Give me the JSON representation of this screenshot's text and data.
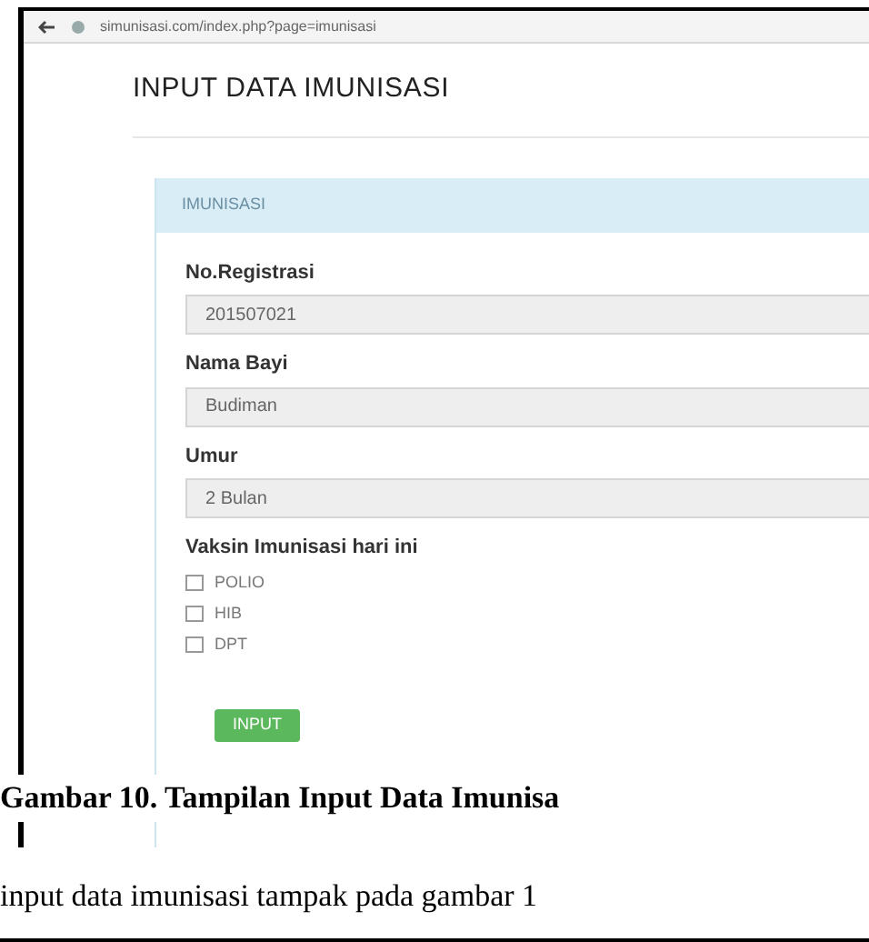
{
  "browser": {
    "url": "simunisasi.com/index.php?page=imunisasi"
  },
  "page": {
    "title": "INPUT DATA IMUNISASI"
  },
  "panel": {
    "heading": "IMUNISASI",
    "fields": [
      {
        "label": "No.Registrasi",
        "value": "201507021"
      },
      {
        "label": "Nama Bayi",
        "value": "Budiman"
      },
      {
        "label": "Umur",
        "value": "2 Bulan"
      }
    ],
    "vaccines_label": "Vaksin Imunisasi hari ini",
    "vaccines": [
      {
        "label": "POLIO",
        "checked": false
      },
      {
        "label": "HIB",
        "checked": false
      },
      {
        "label": "DPT",
        "checked": false
      }
    ],
    "button": "INPUT"
  },
  "caption": "Gambar 10. Tampilan Input Data Imunisa",
  "body_text": "input data imunisasi tampak pada gambar 1"
}
